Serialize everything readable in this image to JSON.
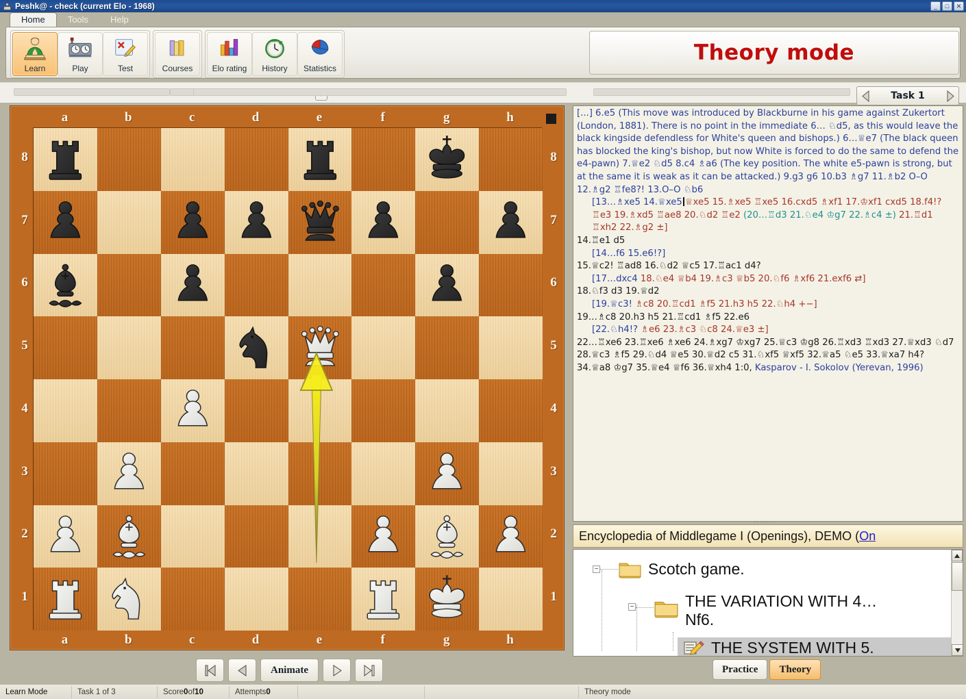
{
  "window": {
    "title": "Peshk@ -  check (current Elo - 1968)",
    "minimize": "_",
    "maximize": "□",
    "close": "✕"
  },
  "ribbon": {
    "tabs": [
      {
        "label": "Home",
        "active": true
      },
      {
        "label": "Tools",
        "active": false
      },
      {
        "label": "Help",
        "active": false
      }
    ],
    "buttons": [
      {
        "label": "Learn",
        "icon": "student-icon",
        "selected": true
      },
      {
        "label": "Play",
        "icon": "chess-clock-icon",
        "selected": false
      },
      {
        "label": "Test",
        "icon": "test-sheet-icon",
        "selected": false
      },
      {
        "label": "Courses",
        "icon": "books-icon",
        "selected": false
      },
      {
        "label": "Elo rating",
        "icon": "bar-chart-icon",
        "selected": false
      },
      {
        "label": "History",
        "icon": "clock-history-icon",
        "selected": false
      },
      {
        "label": "Statistics",
        "icon": "pie-chart-icon",
        "selected": false
      }
    ]
  },
  "mode_banner": {
    "text": "Theory mode",
    "color": "#c00d0d"
  },
  "task_nav": {
    "prev": "◀",
    "label": "Task 1",
    "next": "▶"
  },
  "board": {
    "files": [
      "a",
      "b",
      "c",
      "d",
      "e",
      "f",
      "g",
      "h"
    ],
    "ranks": [
      "8",
      "7",
      "6",
      "5",
      "4",
      "3",
      "2",
      "1"
    ],
    "side_to_move_marker": "black",
    "pieces": [
      {
        "square": "a8",
        "piece": "rook",
        "color": "black"
      },
      {
        "square": "e8",
        "piece": "rook",
        "color": "black"
      },
      {
        "square": "g8",
        "piece": "king",
        "color": "black"
      },
      {
        "square": "a7",
        "piece": "pawn",
        "color": "black"
      },
      {
        "square": "c7",
        "piece": "pawn",
        "color": "black"
      },
      {
        "square": "d7",
        "piece": "pawn",
        "color": "black"
      },
      {
        "square": "e7",
        "piece": "queen",
        "color": "black"
      },
      {
        "square": "f7",
        "piece": "pawn",
        "color": "black"
      },
      {
        "square": "h7",
        "piece": "pawn",
        "color": "black"
      },
      {
        "square": "a6",
        "piece": "bishop",
        "color": "black"
      },
      {
        "square": "c6",
        "piece": "pawn",
        "color": "black"
      },
      {
        "square": "g6",
        "piece": "pawn",
        "color": "black"
      },
      {
        "square": "d5",
        "piece": "knight",
        "color": "black"
      },
      {
        "square": "e5",
        "piece": "queen",
        "color": "white"
      },
      {
        "square": "c4",
        "piece": "pawn",
        "color": "white"
      },
      {
        "square": "b3",
        "piece": "pawn",
        "color": "white"
      },
      {
        "square": "g3",
        "piece": "pawn",
        "color": "white"
      },
      {
        "square": "a2",
        "piece": "pawn",
        "color": "white"
      },
      {
        "square": "b2",
        "piece": "bishop",
        "color": "white"
      },
      {
        "square": "f2",
        "piece": "pawn",
        "color": "white"
      },
      {
        "square": "g2",
        "piece": "bishop",
        "color": "white"
      },
      {
        "square": "h2",
        "piece": "pawn",
        "color": "white"
      },
      {
        "square": "a1",
        "piece": "rook",
        "color": "white"
      },
      {
        "square": "b1",
        "piece": "knight",
        "color": "white"
      },
      {
        "square": "f1",
        "piece": "rook",
        "color": "white"
      },
      {
        "square": "g1",
        "piece": "king",
        "color": "white"
      }
    ],
    "arrow": {
      "from": "e2",
      "to": "e5",
      "color": "#f2e617"
    }
  },
  "board_nav": {
    "first": "⏮",
    "prev": "◀",
    "animate": "Animate",
    "next": "▶",
    "last": "⏭"
  },
  "notation": {
    "paragraphs": [
      {
        "indent": 0,
        "runs": [
          {
            "text": "[...] 6.e5 (This move was introduced by Blackburne in his game against Zukertort (London, 1881). There is no point in the immediate 6… ♘d5, as this would leave the black kingside defendless for  White's queen and bishops.) 6…♕e7 (The black queen has blocked the king's bishop, but now White is forced to do the same to defend the e4-pawn) 7.♕e2 ♘d5 8.c4 ♗a6 (The key position. The white e5-pawn is strong, but at the same it is weak as it can be attacked.) 9.g3 g6 10.b3 ♗g7 11.♗b2 O–O 12.♗g2 ♖fe8?! 13.O–O ♘b6",
            "color": "blue"
          }
        ]
      },
      {
        "indent": 1,
        "runs": [
          {
            "text": "[13…♗xe5 14.♕xe5",
            "color": "blue"
          },
          {
            "text": "|",
            "color": "caret"
          },
          {
            "text": "♕xe5 15.♗xe5 ♖xe5 16.cxd5 ♗xf1 17.♔xf1 cxd5 18.f4!? ♖e3 19.♗xd5 ♖ae8 20.♘d2 ♖e2 ",
            "color": "red"
          },
          {
            "text": "(20…♖d3 21.♘e4 ♔g7 22.♗c4 ±)",
            "color": "teal"
          },
          {
            "text": " 21.♖d1 ♖xh2 22.♗g2 ±]",
            "color": "red"
          }
        ]
      },
      {
        "indent": 0,
        "runs": [
          {
            "text": "14.♖e1 d5",
            "color": "dark"
          }
        ]
      },
      {
        "indent": 1,
        "runs": [
          {
            "text": "[14…f6 15.e6!?]",
            "color": "blue"
          }
        ]
      },
      {
        "indent": 0,
        "runs": [
          {
            "text": "15.♕c2! ♖ad8 16.♘d2 ♕c5 17.♖ac1 d4?",
            "color": "dark"
          }
        ]
      },
      {
        "indent": 1,
        "runs": [
          {
            "text": "[17…dxc4 ",
            "color": "blue"
          },
          {
            "text": "18.♘e4 ♕b4 19.♗c3 ♕b5 20.♘f6 ♗xf6 21.exf6 ⇄]",
            "color": "red"
          }
        ]
      },
      {
        "indent": 0,
        "runs": [
          {
            "text": "18.♘f3 d3 19.♕d2",
            "color": "dark"
          }
        ]
      },
      {
        "indent": 1,
        "runs": [
          {
            "text": "[19.♕c3! ",
            "color": "blue"
          },
          {
            "text": "♗c8 20.♖cd1 ♗f5 21.h3 h5 22.♘h4 +−]",
            "color": "red"
          }
        ]
      },
      {
        "indent": 0,
        "runs": [
          {
            "text": "19…♗c8 20.h3 h5 21.♖cd1 ♗f5 22.e6",
            "color": "dark"
          }
        ]
      },
      {
        "indent": 1,
        "runs": [
          {
            "text": "[22.♘h4!? ",
            "color": "blue"
          },
          {
            "text": "♗e6 23.♗c3 ♘c8 24.♕e3 ±]",
            "color": "red"
          }
        ]
      },
      {
        "indent": 0,
        "runs": [
          {
            "text": "22…♖xe6 23.♖xe6 ♗xe6 24.♗xg7 ♔xg7 25.♕c3 ♔g8 26.♖xd3 ♖xd3 27.♕xd3 ♘d7 28.♕c3 ♗f5 29.♘d4 ♕e5 30.♕d2 c5 31.♘xf5 ♕xf5 32.♕a5 ♘e5 33.♕xa7 h4? 34.♕a8 ♔g7 35.♕e4 ♕f6 36.♕xh4 1:0, ",
            "color": "dark"
          },
          {
            "text": "Kasparov - I. Sokolov (Yerevan, 1996)",
            "color": "blue"
          }
        ]
      }
    ]
  },
  "course": {
    "title": "Encyclopedia of Middlegame I (Openings), DEMO (",
    "link": "On"
  },
  "tree": {
    "nodes": [
      {
        "label": "Scotch game.",
        "icon": "folder-icon",
        "depth": 0,
        "selected": false,
        "expander": "−"
      },
      {
        "label": "THE VARIATION WITH 4…",
        "label2": "Nf6.",
        "icon": "folder-icon",
        "depth": 1,
        "selected": false,
        "expander": "−"
      },
      {
        "label": "THE SYSTEM WITH 5.",
        "icon": "notes-icon",
        "depth": 2,
        "selected": true,
        "expander": ""
      }
    ],
    "scroll_up": "▲",
    "scroll_down": "▼"
  },
  "bottom_buttons": [
    {
      "label": "Practice",
      "active": false
    },
    {
      "label": "Theory",
      "active": true
    }
  ],
  "status_bar": {
    "mode": "Learn Mode",
    "task": "Task 1 of 3",
    "score_prefix": "Score ",
    "score_value": "0",
    "score_mid": " of ",
    "score_total": "10",
    "attempts_prefix": "Attempts ",
    "attempts_value": "0",
    "blank1": "",
    "blank2": "",
    "theory": "Theory mode"
  }
}
